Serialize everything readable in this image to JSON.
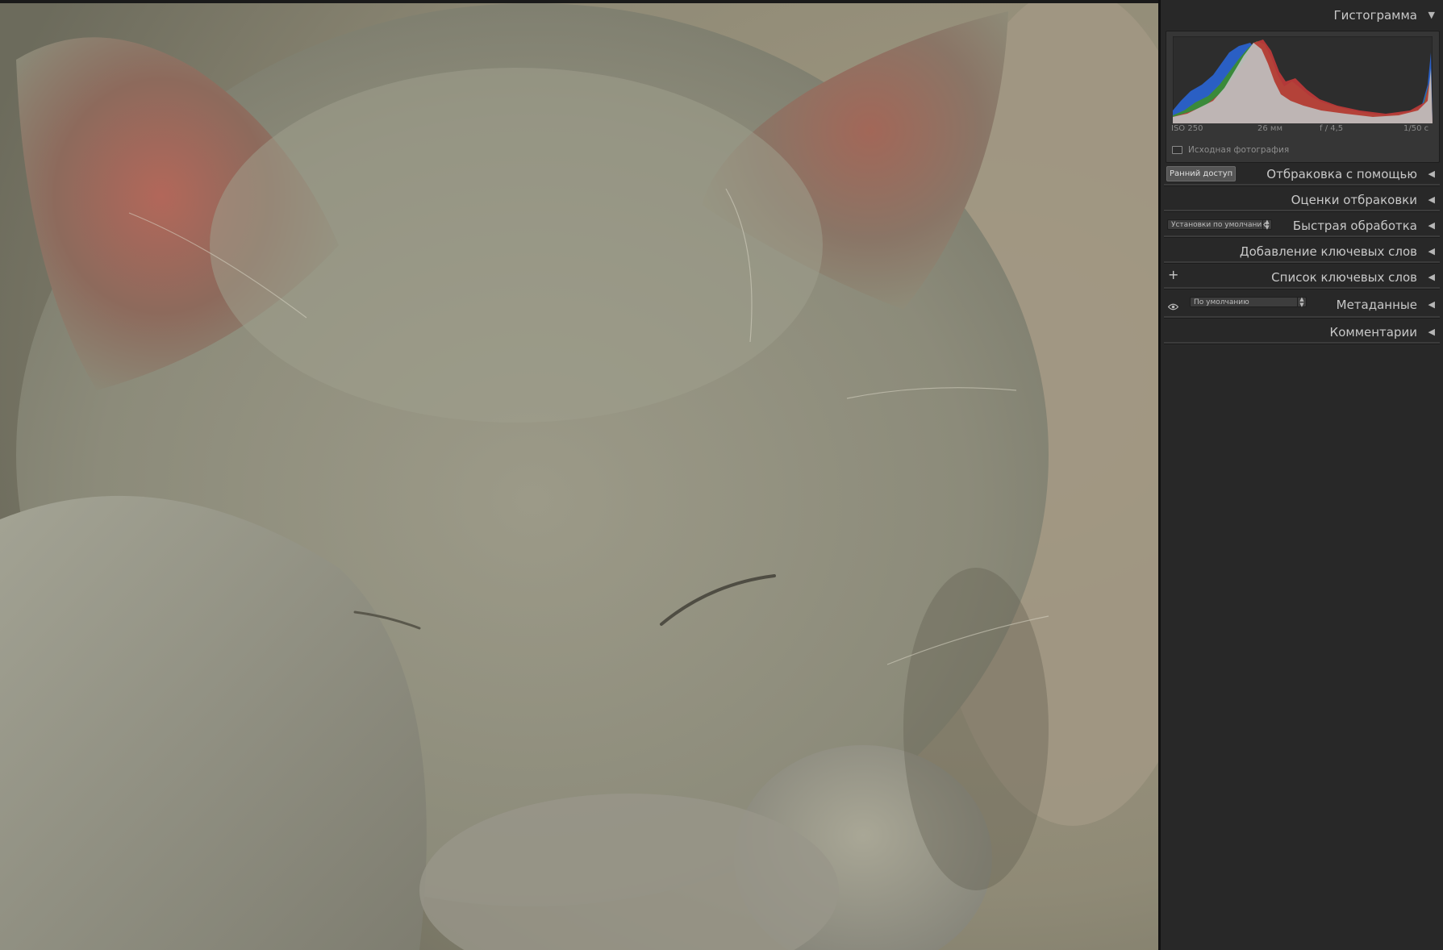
{
  "panel": {
    "histogram_header": "Гистограмма",
    "exif": {
      "iso": "ISO 250",
      "focal": "26 мм",
      "aperture": "f / 4,5",
      "shutter": "1/50 с"
    },
    "original_photo_label": "Исходная фотография",
    "sections": {
      "culling_assist": "Отбраковка с помощью",
      "early_access": "Ранний доступ",
      "culling_ratings": "Оценки отбраковки",
      "quick_develop": "Быстрая обработка",
      "quick_develop_preset": "Установки по умолчанию",
      "keywording": "Добавление ключевых слов",
      "keyword_list": "Список ключевых слов",
      "metadata": "Метаданные",
      "metadata_preset": "По умолчанию",
      "comments": "Комментарии"
    }
  },
  "icons": {
    "collapse": "triangle-left-icon",
    "expand": "triangle-down-icon",
    "add": "plus-icon",
    "visibility": "eye-icon"
  },
  "colors": {
    "panel_bg": "#282828",
    "hist_blue": "#2a5fc4",
    "hist_green": "#3a8a3a",
    "hist_red": "#c23a3a",
    "hist_gray": "#bfbfbf"
  }
}
